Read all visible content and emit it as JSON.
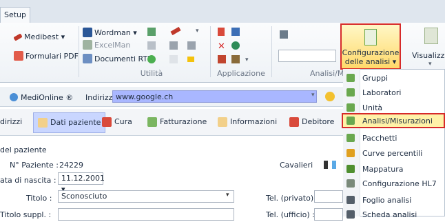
{
  "ribbon": {
    "tab_setup": "Setup",
    "items": {
      "medibest": "Medibest ▾",
      "formulari_pdf": "Formulari PDF",
      "wordman": "Wordman ▾",
      "excelman": "ExcelMan",
      "documenti_rtf": "Documenti RTF"
    },
    "groups": {
      "utilita": "Utilità",
      "applicazione": "Applicazione",
      "analisi": "Analisi/Mis"
    },
    "config_button_line1": "Configurazione",
    "config_button_line2": "delle analisi ▾",
    "visualizza": "Visualizza"
  },
  "toolbar": {
    "medionline": "MediOnline ®",
    "indirizzo_label": "Indirizzo",
    "address_value": "www.google.ch"
  },
  "patient_tabs": [
    {
      "label": "dirizzi"
    },
    {
      "label": "Dati paziente"
    },
    {
      "label": "Cura"
    },
    {
      "label": "Fatturazione"
    },
    {
      "label": "Informazioni"
    },
    {
      "label": "Debitore"
    }
  ],
  "form": {
    "section_title": "del paziente",
    "num_paziente_label": "N° Paziente :",
    "num_paziente_value": "24229",
    "data_nascita_label": "ata di nascita :",
    "data_nascita_value": "11.12.2001 ▾",
    "titolo_label": "Titolo :",
    "titolo_value": "Sconosciuto",
    "cavalieri_label": "Cavalieri",
    "tel_privato_label": "Tel. (privato) :",
    "titolo_suppl_label": "Titolo suppl. :",
    "tel_ufficio_label": "Tel. (ufficio) :"
  },
  "dropdown_menu": {
    "items": [
      {
        "label": "Gruppi",
        "icon": "clipboard-icon",
        "color": "#6aa84f"
      },
      {
        "label": "Laboratori",
        "icon": "clipboard-icon",
        "color": "#6aa84f"
      },
      {
        "label": "Unità",
        "icon": "clipboard-icon",
        "color": "#6aa84f"
      },
      {
        "label": "Analisi/Misurazioni",
        "icon": "clipboard-icon",
        "color": "#6aa84f",
        "selected": true
      },
      {
        "label": "Pacchetti",
        "icon": "clipboard-icon",
        "color": "#6aa84f"
      },
      {
        "label": "Curve percentili",
        "icon": "figure-icon",
        "color": "#e0a020"
      },
      {
        "label": "Mappatura",
        "icon": "bars-icon",
        "color": "#4f8f2f"
      },
      {
        "label": "Configurazione HL7",
        "icon": "flask-icon",
        "color": "#7a8a7a"
      },
      {
        "label": "Foglio analisi",
        "icon": "microscope-icon",
        "color": "#555f6a"
      },
      {
        "label": "Scheda analisi",
        "icon": "microscope-icon",
        "color": "#555f6a"
      }
    ]
  }
}
